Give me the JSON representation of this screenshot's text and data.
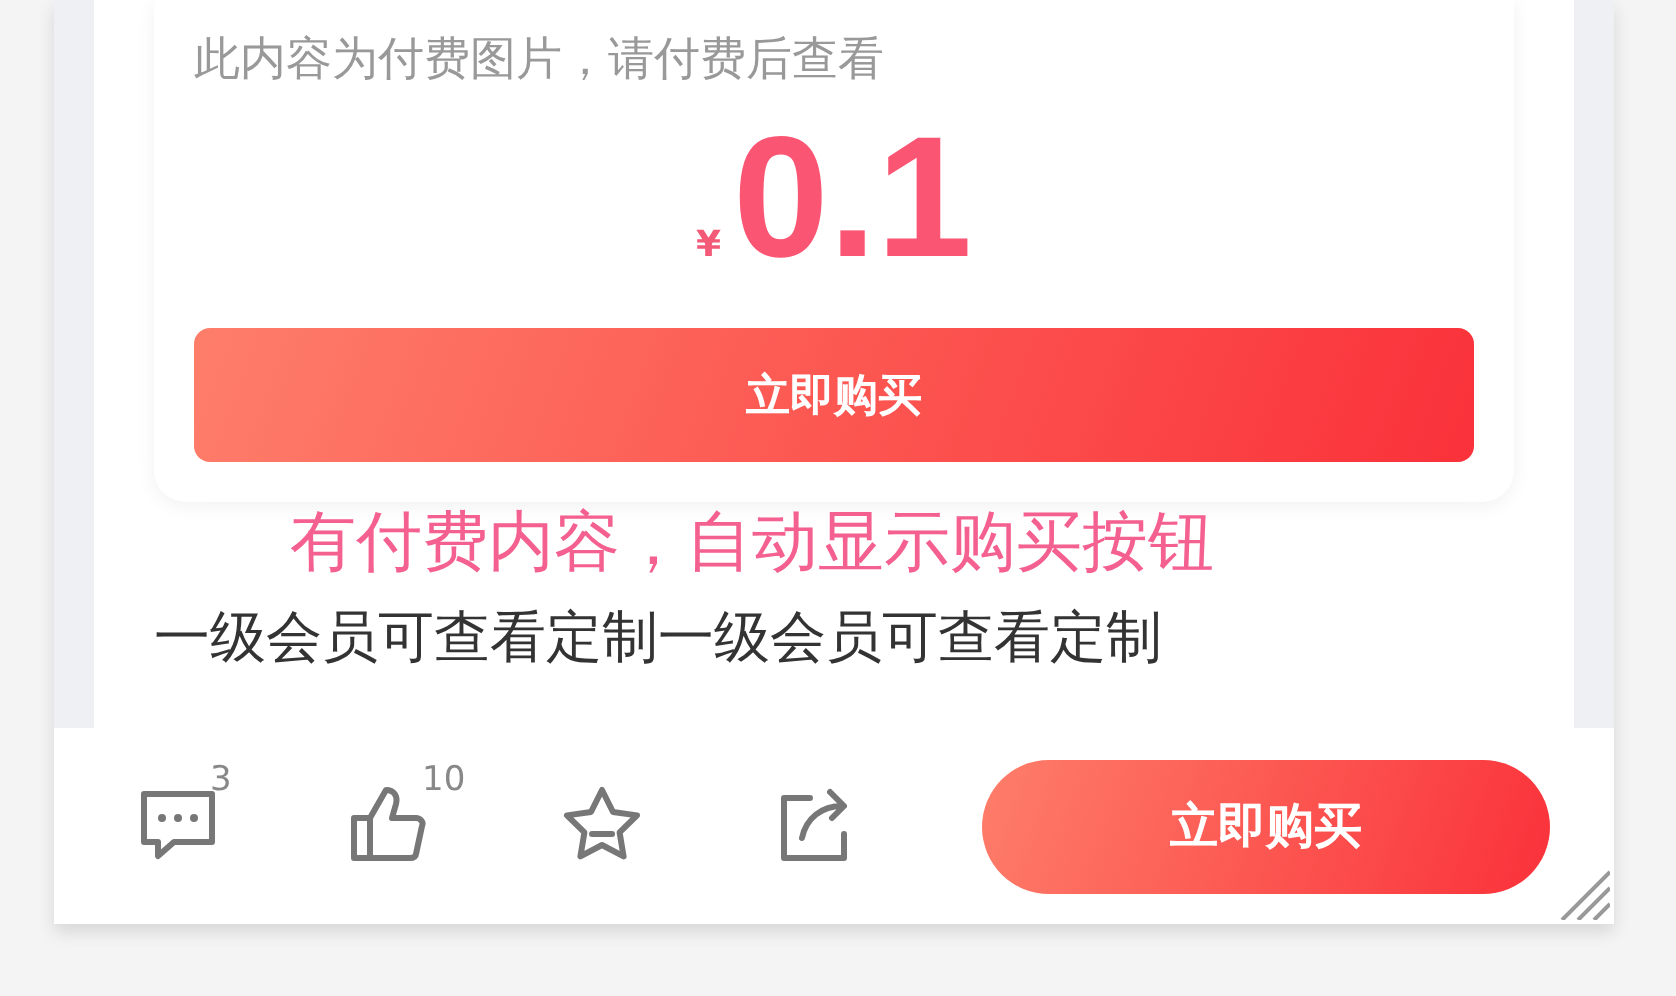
{
  "paywall": {
    "hint": "此内容为付费图片，请付费后查看",
    "currency": "¥",
    "price": "0.1",
    "button": "立即购买"
  },
  "notice": "有付费内容，自动显示购买按钮",
  "body_text": "一级会员可查看定制一级会员可查看定制",
  "action_bar": {
    "actions": [
      {
        "kind": "comment",
        "badge": "3"
      },
      {
        "kind": "like",
        "badge": "10"
      },
      {
        "kind": "favorite"
      },
      {
        "kind": "share"
      }
    ],
    "button": "立即购买"
  }
}
